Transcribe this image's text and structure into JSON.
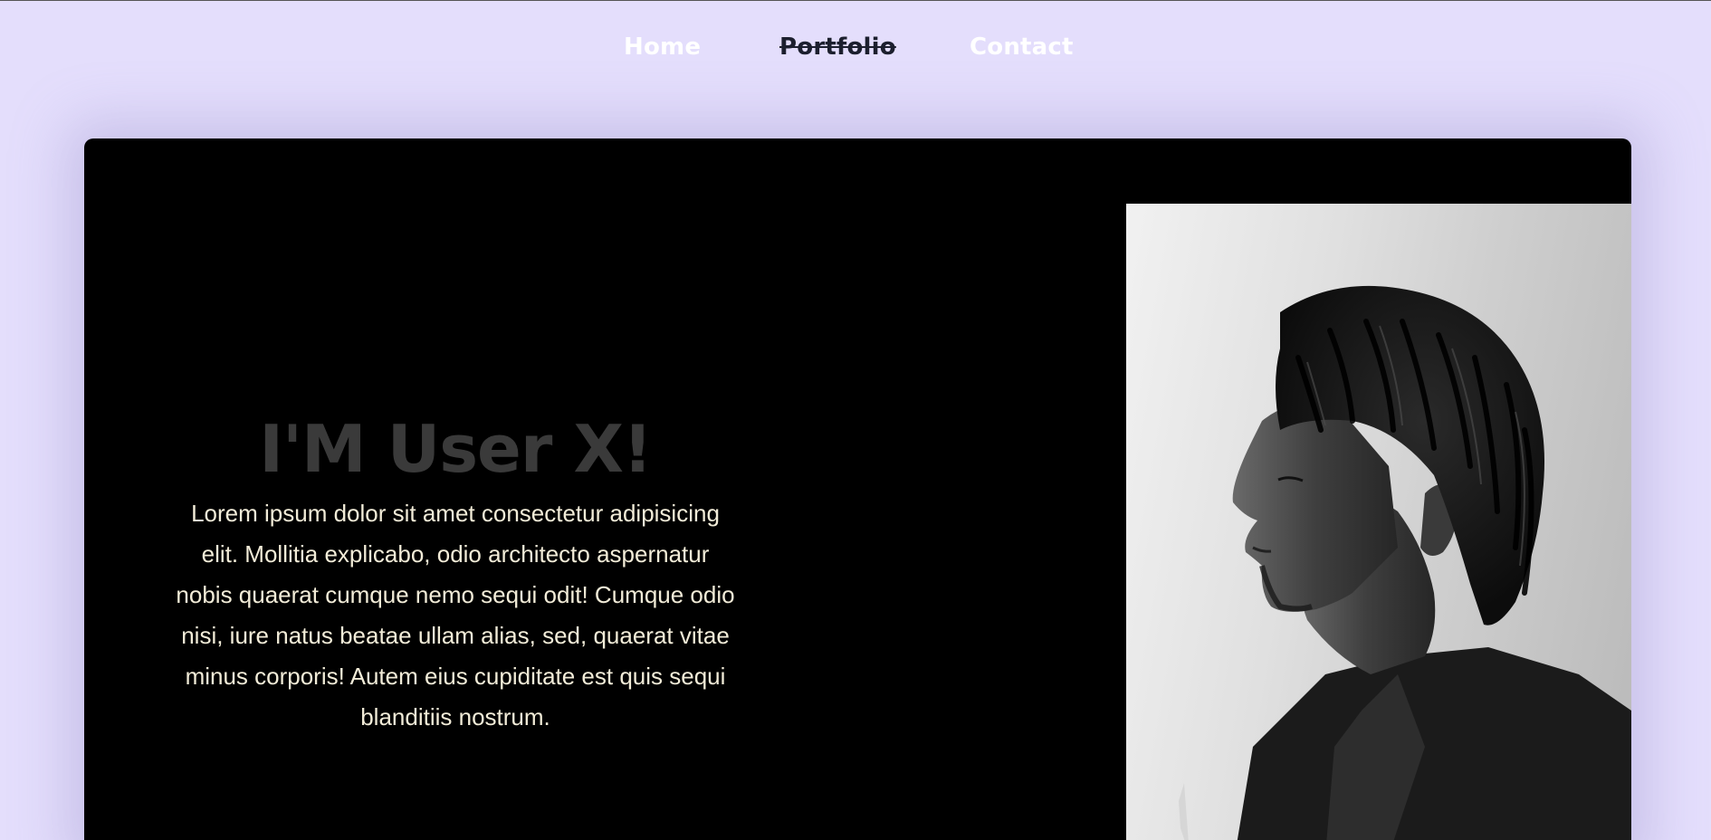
{
  "nav": {
    "items": [
      {
        "label": "Home",
        "state": "normal"
      },
      {
        "label": "Portfolio",
        "state": "active"
      },
      {
        "label": "Contact",
        "state": "normal"
      }
    ]
  },
  "hero": {
    "title": "I'M User X!",
    "body": "Lorem ipsum dolor sit amet consectetur adipisicing elit. Mollitia explicabo, odio architecto aspernatur nobis quaerat cumque nemo sequi odit! Cumque odio nisi, iure natus beatae ullam alias, sed, quaerat vitae minus corporis! Autem eius cupiditate est quis sequi blanditiis nostrum.",
    "image_icon": "portrait-photo"
  },
  "colors": {
    "background": "#e4defc",
    "nav_text": "#ffffff",
    "nav_active": "#1c1f2e",
    "card": "#000000",
    "title": "#3a3a3a",
    "body_text": "#f2ecd8"
  }
}
